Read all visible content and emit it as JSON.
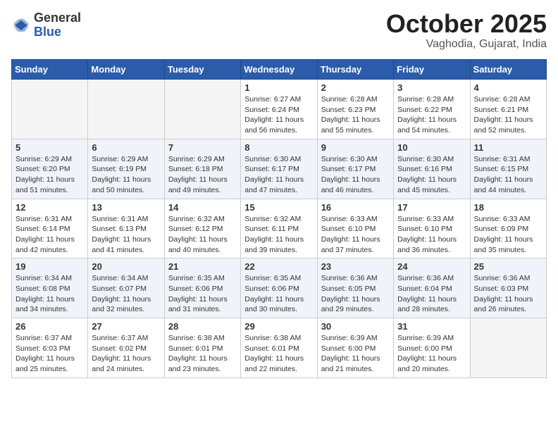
{
  "header": {
    "logo_general": "General",
    "logo_blue": "Blue",
    "title": "October 2025",
    "location": "Vaghodia, Gujarat, India"
  },
  "weekdays": [
    "Sunday",
    "Monday",
    "Tuesday",
    "Wednesday",
    "Thursday",
    "Friday",
    "Saturday"
  ],
  "weeks": [
    [
      {
        "day": "",
        "text": ""
      },
      {
        "day": "",
        "text": ""
      },
      {
        "day": "",
        "text": ""
      },
      {
        "day": "1",
        "text": "Sunrise: 6:27 AM\nSunset: 6:24 PM\nDaylight: 11 hours and 56 minutes."
      },
      {
        "day": "2",
        "text": "Sunrise: 6:28 AM\nSunset: 6:23 PM\nDaylight: 11 hours and 55 minutes."
      },
      {
        "day": "3",
        "text": "Sunrise: 6:28 AM\nSunset: 6:22 PM\nDaylight: 11 hours and 54 minutes."
      },
      {
        "day": "4",
        "text": "Sunrise: 6:28 AM\nSunset: 6:21 PM\nDaylight: 11 hours and 52 minutes."
      }
    ],
    [
      {
        "day": "5",
        "text": "Sunrise: 6:29 AM\nSunset: 6:20 PM\nDaylight: 11 hours and 51 minutes."
      },
      {
        "day": "6",
        "text": "Sunrise: 6:29 AM\nSunset: 6:19 PM\nDaylight: 11 hours and 50 minutes."
      },
      {
        "day": "7",
        "text": "Sunrise: 6:29 AM\nSunset: 6:18 PM\nDaylight: 11 hours and 49 minutes."
      },
      {
        "day": "8",
        "text": "Sunrise: 6:30 AM\nSunset: 6:17 PM\nDaylight: 11 hours and 47 minutes."
      },
      {
        "day": "9",
        "text": "Sunrise: 6:30 AM\nSunset: 6:17 PM\nDaylight: 11 hours and 46 minutes."
      },
      {
        "day": "10",
        "text": "Sunrise: 6:30 AM\nSunset: 6:16 PM\nDaylight: 11 hours and 45 minutes."
      },
      {
        "day": "11",
        "text": "Sunrise: 6:31 AM\nSunset: 6:15 PM\nDaylight: 11 hours and 44 minutes."
      }
    ],
    [
      {
        "day": "12",
        "text": "Sunrise: 6:31 AM\nSunset: 6:14 PM\nDaylight: 11 hours and 42 minutes."
      },
      {
        "day": "13",
        "text": "Sunrise: 6:31 AM\nSunset: 6:13 PM\nDaylight: 11 hours and 41 minutes."
      },
      {
        "day": "14",
        "text": "Sunrise: 6:32 AM\nSunset: 6:12 PM\nDaylight: 11 hours and 40 minutes."
      },
      {
        "day": "15",
        "text": "Sunrise: 6:32 AM\nSunset: 6:11 PM\nDaylight: 11 hours and 39 minutes."
      },
      {
        "day": "16",
        "text": "Sunrise: 6:33 AM\nSunset: 6:10 PM\nDaylight: 11 hours and 37 minutes."
      },
      {
        "day": "17",
        "text": "Sunrise: 6:33 AM\nSunset: 6:10 PM\nDaylight: 11 hours and 36 minutes."
      },
      {
        "day": "18",
        "text": "Sunrise: 6:33 AM\nSunset: 6:09 PM\nDaylight: 11 hours and 35 minutes."
      }
    ],
    [
      {
        "day": "19",
        "text": "Sunrise: 6:34 AM\nSunset: 6:08 PM\nDaylight: 11 hours and 34 minutes."
      },
      {
        "day": "20",
        "text": "Sunrise: 6:34 AM\nSunset: 6:07 PM\nDaylight: 11 hours and 32 minutes."
      },
      {
        "day": "21",
        "text": "Sunrise: 6:35 AM\nSunset: 6:06 PM\nDaylight: 11 hours and 31 minutes."
      },
      {
        "day": "22",
        "text": "Sunrise: 6:35 AM\nSunset: 6:06 PM\nDaylight: 11 hours and 30 minutes."
      },
      {
        "day": "23",
        "text": "Sunrise: 6:36 AM\nSunset: 6:05 PM\nDaylight: 11 hours and 29 minutes."
      },
      {
        "day": "24",
        "text": "Sunrise: 6:36 AM\nSunset: 6:04 PM\nDaylight: 11 hours and 28 minutes."
      },
      {
        "day": "25",
        "text": "Sunrise: 6:36 AM\nSunset: 6:03 PM\nDaylight: 11 hours and 26 minutes."
      }
    ],
    [
      {
        "day": "26",
        "text": "Sunrise: 6:37 AM\nSunset: 6:03 PM\nDaylight: 11 hours and 25 minutes."
      },
      {
        "day": "27",
        "text": "Sunrise: 6:37 AM\nSunset: 6:02 PM\nDaylight: 11 hours and 24 minutes."
      },
      {
        "day": "28",
        "text": "Sunrise: 6:38 AM\nSunset: 6:01 PM\nDaylight: 11 hours and 23 minutes."
      },
      {
        "day": "29",
        "text": "Sunrise: 6:38 AM\nSunset: 6:01 PM\nDaylight: 11 hours and 22 minutes."
      },
      {
        "day": "30",
        "text": "Sunrise: 6:39 AM\nSunset: 6:00 PM\nDaylight: 11 hours and 21 minutes."
      },
      {
        "day": "31",
        "text": "Sunrise: 6:39 AM\nSunset: 6:00 PM\nDaylight: 11 hours and 20 minutes."
      },
      {
        "day": "",
        "text": ""
      }
    ]
  ]
}
